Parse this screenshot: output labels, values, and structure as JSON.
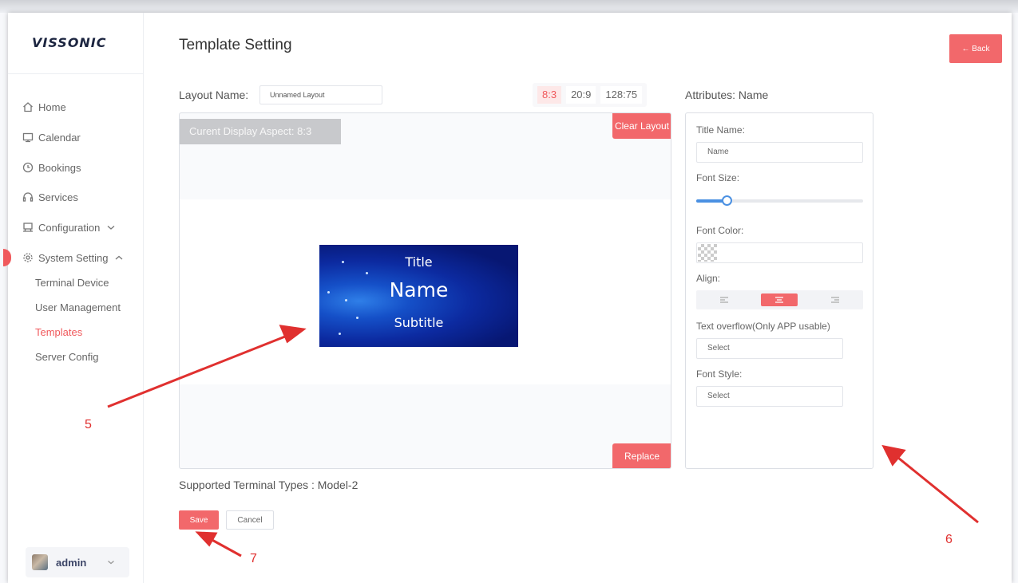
{
  "brand": {
    "logo_text": "VISSONIC"
  },
  "sidebar": {
    "items": [
      {
        "label": "Home",
        "icon": "home-icon"
      },
      {
        "label": "Calendar",
        "icon": "calendar-icon"
      },
      {
        "label": "Bookings",
        "icon": "clock-icon"
      },
      {
        "label": "Services",
        "icon": "headset-icon"
      },
      {
        "label": "Configuration",
        "icon": "computer-icon"
      },
      {
        "label": "System Setting",
        "icon": "gear-icon"
      }
    ],
    "sub_items": [
      {
        "label": "Terminal Device",
        "active": false
      },
      {
        "label": "User Management",
        "active": false
      },
      {
        "label": "Templates",
        "active": true
      },
      {
        "label": "Server Config",
        "active": false
      }
    ],
    "user": {
      "name": "admin"
    }
  },
  "header": {
    "title": "Template Setting",
    "back_label": "← Back"
  },
  "layout": {
    "name_label": "Layout Name:",
    "name_value": "Unnamed Layout",
    "aspects": [
      "8:3",
      "20:9",
      "128:75"
    ],
    "selected_aspect": "8:3"
  },
  "canvas": {
    "current_aspect_label": "Curent Display Aspect:  8:3",
    "clear_label": "Clear Layout",
    "replace_label": "Replace",
    "preview": {
      "title": "Title",
      "name": "Name",
      "subtitle": "Subtitle"
    }
  },
  "attributes": {
    "header": "Attributes:  Name",
    "title_name_label": "Title Name:",
    "title_name_value": "Name",
    "font_size_label": "Font Size:",
    "font_size_level": 0.18,
    "font_color_label": "Font Color:",
    "align_label": "Align:",
    "align_options": [
      "left",
      "center",
      "right"
    ],
    "align_selected": "center",
    "overflow_label": "Text overflow(Only APP usable)",
    "overflow_placeholder": "Select",
    "font_style_label": "Font Style:",
    "font_style_placeholder": "Select"
  },
  "footer": {
    "supported_label": "Supported Terminal Types :  Model-2",
    "save_label": "Save",
    "cancel_label": "Cancel"
  },
  "annotations": {
    "marker_5": "5",
    "marker_6": "6",
    "marker_7": "7",
    "color": "#e0302f"
  },
  "colors": {
    "accent": "#f2686b",
    "slider": "#4a90e2",
    "preview_bg": "#0c2aa0"
  }
}
